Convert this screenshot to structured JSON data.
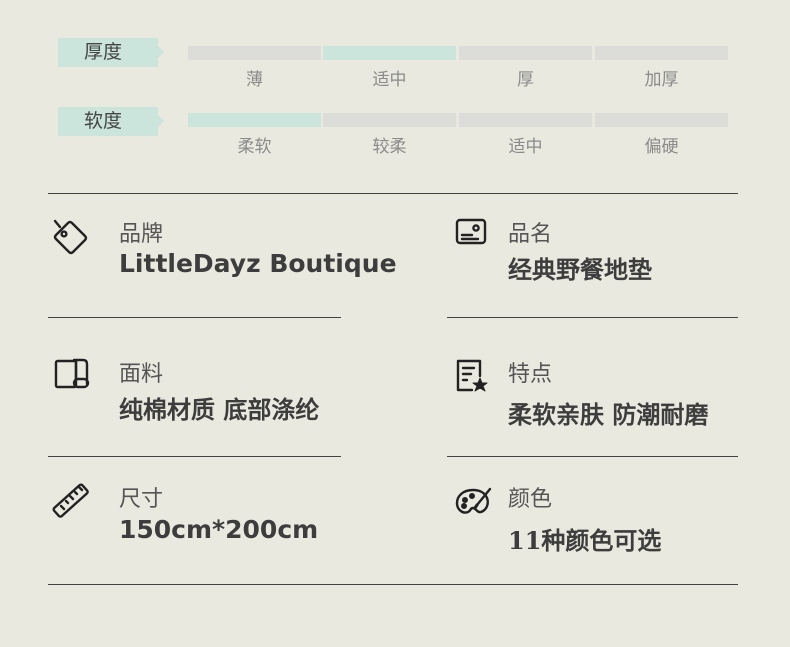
{
  "thickness": {
    "tag": "厚度",
    "levels": [
      "薄",
      "适中",
      "厚",
      "加厚"
    ],
    "selected_index": 1
  },
  "softness": {
    "tag": "软度",
    "levels": [
      "柔软",
      "较柔",
      "适中",
      "偏硬"
    ],
    "selected_index": 0
  },
  "specs": [
    {
      "icon": "price-tag-icon",
      "label": "品牌",
      "value": "LittleDayz Boutique"
    },
    {
      "icon": "product-card-icon",
      "label": "品名",
      "value": "经典野餐地垫"
    },
    {
      "icon": "fabric-roll-icon",
      "label": "面料",
      "value": "纯棉材质 底部涤纶"
    },
    {
      "icon": "document-star-icon",
      "label": "特点",
      "value": "柔软亲肤 防潮耐磨"
    },
    {
      "icon": "ruler-icon",
      "label": "尺寸",
      "value": "150cm*200cm"
    },
    {
      "icon": "palette-icon",
      "label": "颜色",
      "value": "11种颜色可选"
    }
  ],
  "colors": {
    "background": "#eae9df",
    "accent": "#cbe4dc",
    "bar_inactive": "#dcdcd8",
    "line": "#444444"
  }
}
